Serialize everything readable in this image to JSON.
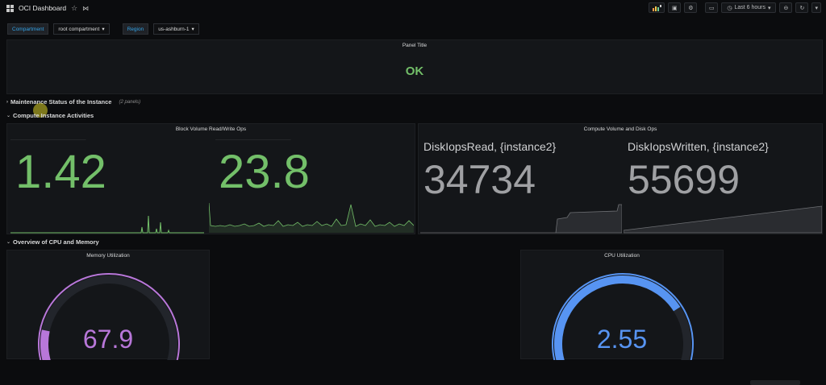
{
  "header": {
    "title": "OCI Dashboard",
    "time_range": "Last 6 hours"
  },
  "variables": [
    {
      "label": "Compartment",
      "value": "root compartment"
    },
    {
      "label": "Region",
      "value": "us-ashburn-1"
    }
  ],
  "panels": {
    "top": {
      "title": "Panel Title",
      "value": "OK"
    },
    "block_volume": {
      "title": "Block Volume Read/Write Ops",
      "values": [
        "1.42",
        "23.8"
      ]
    },
    "compute_volume": {
      "title": "Compute Volume and Disk Ops",
      "stats": [
        {
          "label": "DiskIopsRead, {instance2}",
          "value": "34734"
        },
        {
          "label": "DiskIopsWritten, {instance2}",
          "value": "55699"
        }
      ]
    },
    "memory": {
      "title": "Memory Utilization",
      "value": "67.9",
      "fraction": 0.679
    },
    "cpu": {
      "title": "CPU Utilization",
      "value": "2.55",
      "fraction": 0.0255
    }
  },
  "rows": {
    "maintenance": {
      "title": "Maintenance Status of the Instance",
      "sub": "(2 panels)"
    },
    "compute": {
      "title": "Compute Instance Activities"
    },
    "overview": {
      "title": "Overview of CPU and Memory"
    }
  },
  "colors": {
    "green": "#73bf69",
    "purple": "#b877d9",
    "blue": "#5794f2",
    "gauge_track": "#22252b"
  }
}
